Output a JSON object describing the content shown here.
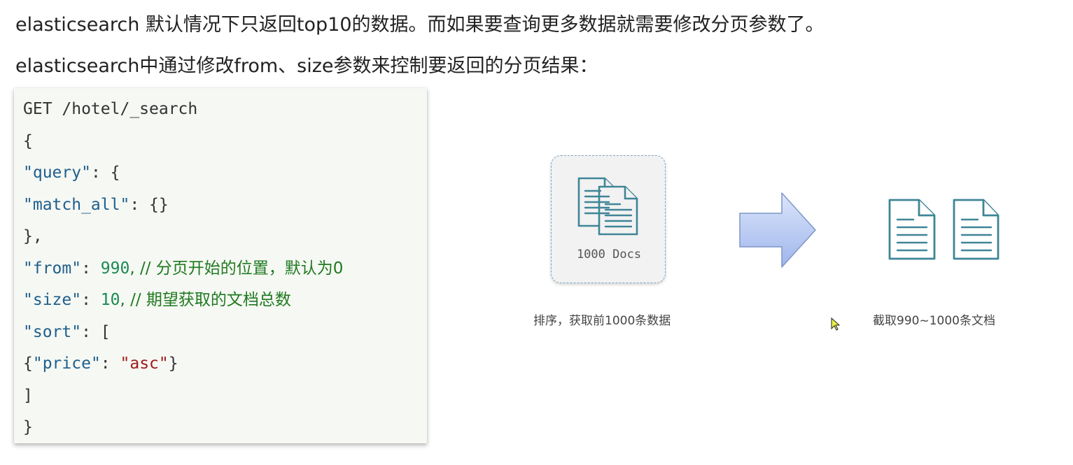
{
  "intro": {
    "line1": "elasticsearch 默认情况下只返回top10的数据。而如果要查询更多数据就需要修改分页参数了。",
    "line2": "elasticsearch中通过修改from、size参数来控制要返回的分页结果："
  },
  "code": {
    "request": "GET /hotel/_search",
    "open_brace": "{",
    "query_key": "\"query\"",
    "query_open": ": {",
    "match_all_key": "\"match_all\"",
    "match_all_val": ": {}",
    "query_close": "},",
    "from_key": "\"from\"",
    "from_val": "990",
    "from_comment": ", // 分页开始的位置，默认为0",
    "size_key": "\"size\"",
    "size_val": "10",
    "size_comment": ", // 期望获取的文档总数",
    "sort_key": "\"sort\"",
    "sort_open": ": [",
    "price_open": "{",
    "price_key": "\"price\"",
    "price_sep": ": ",
    "price_val": "\"asc\"",
    "price_close": "}",
    "sort_close": "]",
    "close_brace": "}"
  },
  "diagram": {
    "docs_label": "1000 Docs",
    "caption_left": "排序，获取前1000条数据",
    "caption_right": "截取990~1000条文档",
    "icon_color": "#3f8597",
    "arrow_fill": "#b7c9f5",
    "arrow_stroke": "#7f96c7",
    "left_icon": "documents-icon",
    "right_icon": "document-icon",
    "cursor_icon": "mouse-cursor-icon"
  }
}
